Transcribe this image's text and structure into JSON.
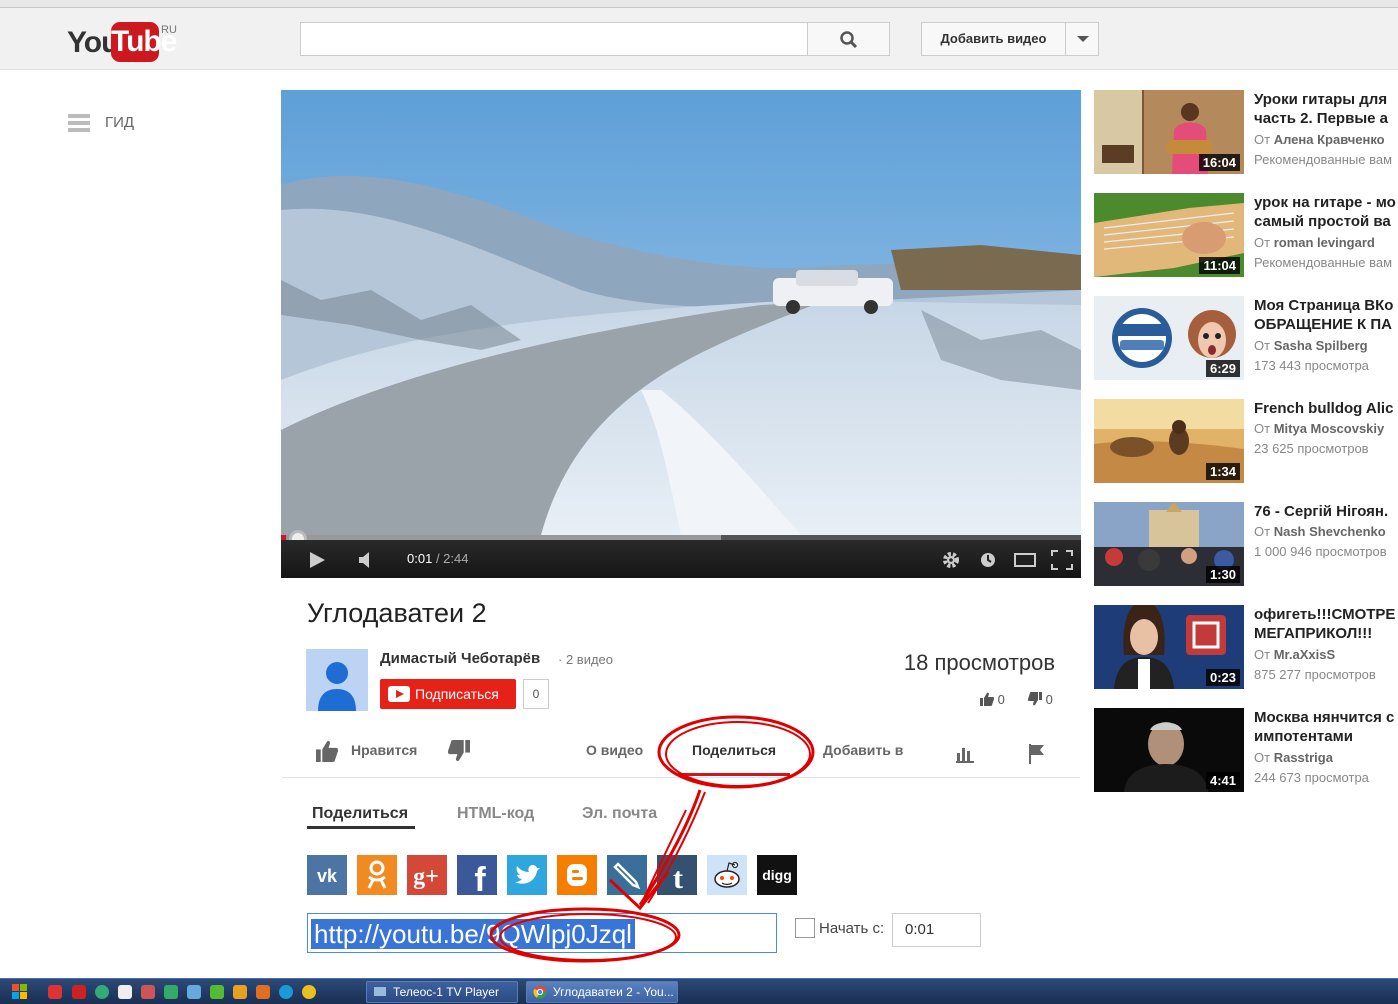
{
  "masthead": {
    "logo_you": "You",
    "logo_tube": "Tube",
    "logo_region": "RU",
    "search_value": "",
    "upload_label": "Добавить видео"
  },
  "guide": {
    "label": "ГИД"
  },
  "player": {
    "current_time": "0:01",
    "duration": "2:44",
    "progress_fraction": 0.006,
    "buffered_fraction": 0.55
  },
  "video": {
    "title": "Углодаватеи 2",
    "owner": "Димастый Чеботарёв",
    "owner_videos": "· 2 видео",
    "subscribe_label": "Подписаться",
    "subscriber_count": "0",
    "views": "18 просмотров",
    "likes": "0",
    "dislikes": "0"
  },
  "actions": {
    "like_label": "Нравится",
    "about_label": "О видео",
    "share_label": "Поделиться",
    "add_to_label": "Добавить в"
  },
  "share": {
    "tabs": [
      "Поделиться",
      "HTML-код",
      "Эл. почта"
    ],
    "social": [
      {
        "name": "vk",
        "glyph": "vk",
        "color": "#4c75a3"
      },
      {
        "name": "odnoklassniki",
        "glyph": "ok",
        "color": "#f18b21"
      },
      {
        "name": "google-plus",
        "glyph": "g+",
        "color": "#d34836"
      },
      {
        "name": "facebook",
        "glyph": "f",
        "color": "#3b5998"
      },
      {
        "name": "twitter",
        "glyph": "t",
        "color": "#2fa6dd"
      },
      {
        "name": "blogger",
        "glyph": "B",
        "color": "#f57d00"
      },
      {
        "name": "livejournal",
        "glyph": "lj",
        "color": "#3a6f9c"
      },
      {
        "name": "tumblr",
        "glyph": "t",
        "color": "#34526f"
      },
      {
        "name": "reddit",
        "glyph": "reddit",
        "color": "#cee3f8"
      },
      {
        "name": "digg",
        "glyph": "digg",
        "color": "#111111"
      }
    ],
    "url": "http://youtu.be/9QWlpj0Jzql",
    "start_label": "Начать с:",
    "start_time": "0:01"
  },
  "related": [
    {
      "title": "Уроки гитары для",
      "title2": "часть 2. Первые а",
      "owner_prefix": "От",
      "owner": "Алена Кравченко",
      "meta": "Рекомендованные вам",
      "duration": "16:04"
    },
    {
      "title": "урок на гитаре - мо",
      "title2": "самый простой ва",
      "owner_prefix": "От",
      "owner": "roman levingard",
      "meta": "Рекомендованные вам",
      "duration": "11:04"
    },
    {
      "title": "Моя Страница ВКо",
      "title2": "ОБРАЩЕНИЕ К ПА",
      "owner_prefix": "От",
      "owner": "Sasha Spilberg",
      "meta": "173 443 просмотра",
      "duration": "6:29"
    },
    {
      "title": "French bulldog Alic",
      "title2": "",
      "owner_prefix": "От",
      "owner": "Mitya Moscovskiy",
      "meta": "23 625 просмотров",
      "duration": "1:34"
    },
    {
      "title": "76 - Сергій Нігоян.",
      "title2": "",
      "owner_prefix": "От",
      "owner": "Nash Shevchenko",
      "meta": "1 000 946 просмотров",
      "duration": "1:30"
    },
    {
      "title": "офигеть!!!СМОТРЕ",
      "title2": "МЕГАПРИКОЛ!!!",
      "owner_prefix": "От",
      "owner": "Mr.aXxisS",
      "meta": "875 277 просмотров",
      "duration": "0:23"
    },
    {
      "title": "Москва нянчится с",
      "title2": "импотентами",
      "owner_prefix": "От",
      "owner": "Rasstriga",
      "meta": "244 673 просмотра",
      "duration": "4:41"
    }
  ],
  "taskbar": {
    "tasks": [
      {
        "label": "Телеос-1 TV Player"
      },
      {
        "label": "Углодаватеи 2 - You..."
      }
    ]
  },
  "colors": {
    "brand_red": "#cc181e",
    "annotation_red": "#e00000",
    "selection_blue": "#3875d7"
  }
}
